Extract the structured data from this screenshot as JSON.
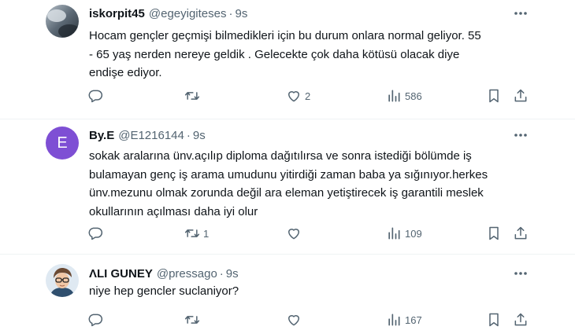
{
  "tweets": [
    {
      "name": "iskorpit45",
      "handle": "@egeyigiteses",
      "dot": "·",
      "time": "9s",
      "text": "Hocam gençler geçmişi bilmedikleri için bu durum onlara normal geliyor. 55\n- 65 yaş nerden nereye geldik . Gelecekte çok daha kötüsü olacak diye\nendişe ediyor.",
      "reply_count": "",
      "retweet_count": "",
      "like_count": "2",
      "view_count": "586"
    },
    {
      "name": "By.E",
      "handle": "@E1216144",
      "dot": "·",
      "time": "9s",
      "avatar_letter": "E",
      "text": "sokak aralarına ünv.açılıp diploma dağıtılırsa ve sonra istediği bölümde iş\nbulamayan genç iş arama umudunu yitirdiği zaman baba ya sığınıyor.herkes\nünv.mezunu olmak zorunda değil ara eleman yetiştirecek iş garantili meslek\nokullarının açılması daha iyi olur",
      "reply_count": "",
      "retweet_count": "1",
      "like_count": "",
      "view_count": "109"
    },
    {
      "name": "ΛLI GUNEY",
      "handle": "@pressago",
      "dot": "·",
      "time": "9s",
      "text": "niye hep gencler suclaniyor?",
      "reply_count": "",
      "retweet_count": "",
      "like_count": "",
      "view_count": "167"
    }
  ],
  "colors": {
    "text": "#0f1419",
    "muted": "#536471",
    "avatar_purple": "#7e4fd4",
    "divider": "#eff3f4"
  },
  "icons": [
    "more-icon",
    "reply-icon",
    "retweet-icon",
    "like-icon",
    "views-icon",
    "bookmark-icon",
    "share-icon"
  ]
}
